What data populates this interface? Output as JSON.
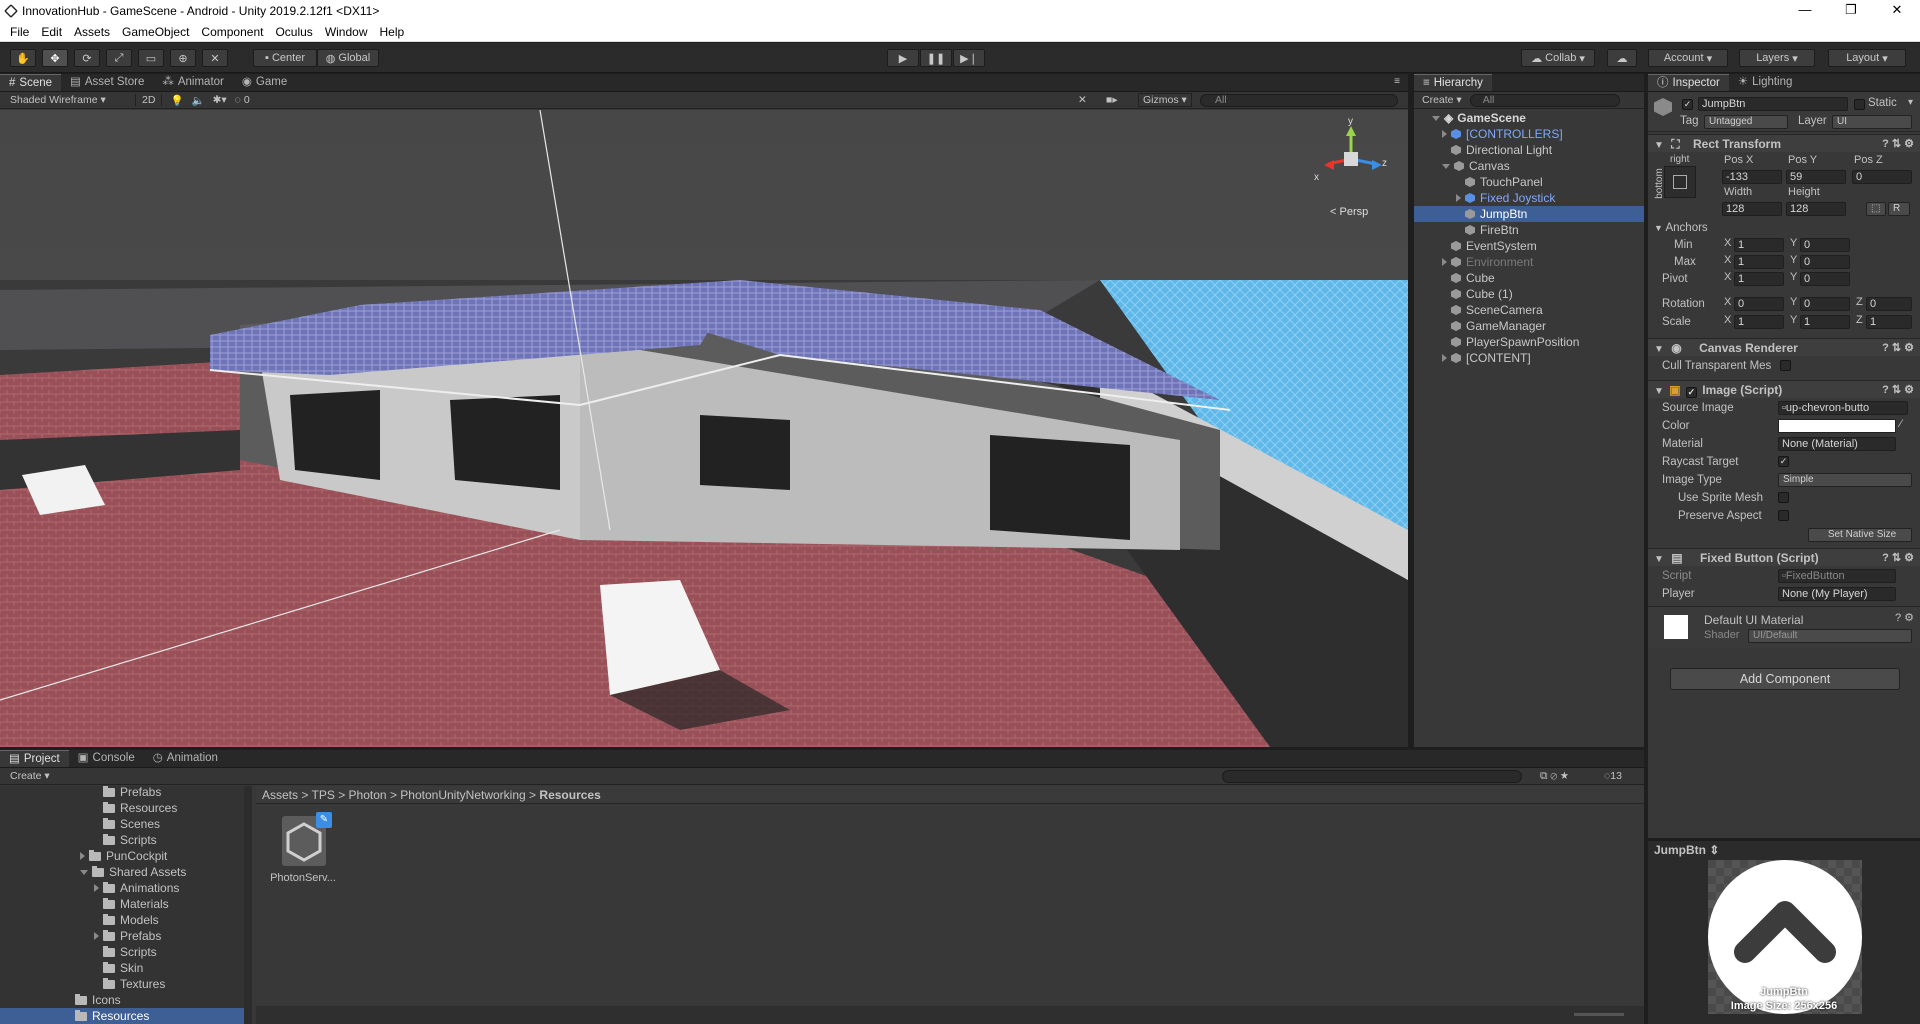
{
  "window": {
    "title": "InnovationHub - GameScene - Android - Unity 2019.2.12f1 <DX11>",
    "controls": [
      "—",
      "❐",
      "✕"
    ]
  },
  "menu": [
    "File",
    "Edit",
    "Assets",
    "GameObject",
    "Component",
    "Oculus",
    "Window",
    "Help"
  ],
  "toolbar": {
    "pivot": "Center",
    "space": "Global",
    "collab": "Collab",
    "account": "Account",
    "layers": "Layers",
    "layout": "Layout"
  },
  "scene_panel": {
    "tabs": [
      "Scene",
      "Asset Store",
      "Animator",
      "Game"
    ],
    "shading": "Shaded Wireframe",
    "mode_2d": "2D",
    "fx_count": "0",
    "gizmos": "Gizmos",
    "search_placeholder": "All",
    "persp": "Persp",
    "axes": {
      "x": "x",
      "y": "y",
      "z": "z"
    }
  },
  "hierarchy": {
    "tab": "Hierarchy",
    "create": "Create",
    "search_placeholder": "All",
    "scene": "GameScene",
    "items": [
      {
        "label": "[CONTROLLERS]",
        "style": "prefab",
        "arrow": "right"
      },
      {
        "label": "Directional Light",
        "style": "normal",
        "arrow": ""
      },
      {
        "label": "Canvas",
        "style": "normal",
        "arrow": "down"
      },
      {
        "label": "TouchPanel",
        "style": "normal",
        "arrow": ""
      },
      {
        "label": "Fixed Joystick",
        "style": "prefab",
        "arrow": "right"
      },
      {
        "label": "JumpBtn",
        "style": "selected",
        "arrow": ""
      },
      {
        "label": "FireBtn",
        "style": "normal",
        "arrow": ""
      },
      {
        "label": "EventSystem",
        "style": "normal",
        "arrow": ""
      },
      {
        "label": "Environment",
        "style": "disabled",
        "arrow": "right"
      },
      {
        "label": "Cube",
        "style": "normal",
        "arrow": ""
      },
      {
        "label": "Cube (1)",
        "style": "normal",
        "arrow": ""
      },
      {
        "label": "SceneCamera",
        "style": "normal",
        "arrow": ""
      },
      {
        "label": "GameManager",
        "style": "normal",
        "arrow": ""
      },
      {
        "label": "PlayerSpawnPosition",
        "style": "normal",
        "arrow": ""
      },
      {
        "label": "[CONTENT]",
        "style": "normal",
        "arrow": "right"
      }
    ]
  },
  "inspector": {
    "tabs": [
      "Inspector",
      "Lighting"
    ],
    "object_name": "JumpBtn",
    "static": "Static",
    "tag_label": "Tag",
    "tag": "Untagged",
    "layer_label": "Layer",
    "layer": "UI",
    "rect": {
      "title": "Rect Transform",
      "anchor_h": "right",
      "anchor_v": "bottom",
      "pos_x_label": "Pos X",
      "pos_y_label": "Pos Y",
      "pos_z_label": "Pos Z",
      "pos_x": "-133",
      "pos_y": "59",
      "pos_z": "0",
      "width_label": "Width",
      "height_label": "Height",
      "width": "128",
      "height": "128",
      "r_btn": "R",
      "anchors": "Anchors",
      "min": "Min",
      "max": "Max",
      "pivot": "Pivot",
      "min_x": "1",
      "min_y": "0",
      "max_x": "1",
      "max_y": "0",
      "pivot_x": "1",
      "pivot_y": "0",
      "rotation": "Rotation",
      "scale": "Scale",
      "rot_x": "0",
      "rot_y": "0",
      "rot_z": "0",
      "scale_x": "1",
      "scale_y": "1",
      "scale_z": "1",
      "X": "X",
      "Y": "Y",
      "Z": "Z"
    },
    "canvas_renderer": {
      "title": "Canvas Renderer",
      "cull": "Cull Transparent Mes"
    },
    "image": {
      "title": "Image (Script)",
      "source_label": "Source Image",
      "source": "up-chevron-butto",
      "color_label": "Color",
      "material_label": "Material",
      "material": "None (Material)",
      "raycast_label": "Raycast Target",
      "type_label": "Image Type",
      "type": "Simple",
      "sprite_mesh": "Use Sprite Mesh",
      "preserve": "Preserve Aspect",
      "native": "Set Native Size"
    },
    "fixed_button": {
      "title": "Fixed Button (Script)",
      "script_label": "Script",
      "script": "FixedButton",
      "player_label": "Player",
      "player": "None (My Player)"
    },
    "material": {
      "title": "Default UI Material",
      "shader_label": "Shader",
      "shader": "UI/Default"
    },
    "add_component": "Add Component",
    "preview_title": "JumpBtn",
    "preview_caption1": "JumpBtn",
    "preview_caption2": "Image Size: 256x256"
  },
  "project": {
    "tabs": [
      "Project",
      "Console",
      "Animation"
    ],
    "create": "Create",
    "count": "13",
    "breadcrumb": [
      "Assets",
      "TPS",
      "Photon",
      "PhotonUnityNetworking",
      "Resources"
    ],
    "tree": [
      {
        "label": "Prefabs",
        "indent": 2,
        "arrow": ""
      },
      {
        "label": "Resources",
        "indent": 2,
        "arrow": ""
      },
      {
        "label": "Scenes",
        "indent": 2,
        "arrow": ""
      },
      {
        "label": "Scripts",
        "indent": 2,
        "arrow": ""
      },
      {
        "label": "PunCockpit",
        "indent": 1,
        "arrow": "right"
      },
      {
        "label": "Shared Assets",
        "indent": 1,
        "arrow": "down"
      },
      {
        "label": "Animations",
        "indent": 2,
        "arrow": "right"
      },
      {
        "label": "Materials",
        "indent": 2,
        "arrow": ""
      },
      {
        "label": "Models",
        "indent": 2,
        "arrow": ""
      },
      {
        "label": "Prefabs",
        "indent": 2,
        "arrow": "right"
      },
      {
        "label": "Scripts",
        "indent": 2,
        "arrow": ""
      },
      {
        "label": "Skin",
        "indent": 2,
        "arrow": ""
      },
      {
        "label": "Textures",
        "indent": 2,
        "arrow": ""
      },
      {
        "label": "Icons",
        "indent": 0,
        "arrow": ""
      },
      {
        "label": "Resources",
        "indent": 0,
        "arrow": ""
      }
    ],
    "asset": "PhotonServ..."
  }
}
